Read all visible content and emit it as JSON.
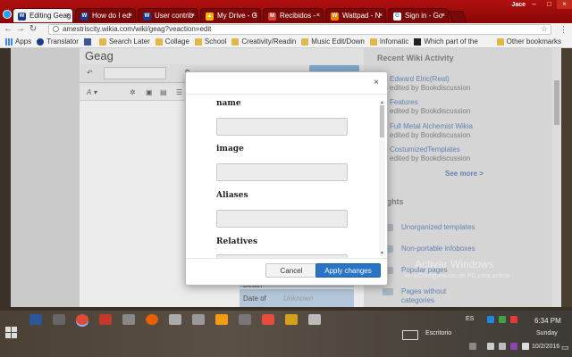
{
  "browser": {
    "profile": "Jace",
    "tabs": [
      {
        "title": "Editing Geag",
        "icon_color": "#1a3b8c",
        "icon": "W",
        "active": true
      },
      {
        "title": "How do I ed",
        "icon_color": "#1a3b8c",
        "icon": "W",
        "active": false
      },
      {
        "title": "User contrib",
        "icon_color": "#1a3b8c",
        "icon": "W",
        "active": false
      },
      {
        "title": "My Drive - G",
        "icon_color": "#f4b400",
        "icon": "▲",
        "active": false
      },
      {
        "title": "Recibidos -",
        "icon_color": "#db4437",
        "icon": "M",
        "active": false
      },
      {
        "title": "Wattpad - N",
        "icon_color": "#f57c00",
        "icon": "W",
        "active": false
      },
      {
        "title": "Sign in - Go",
        "icon_color": "#ffffff",
        "icon": "G",
        "active": false
      }
    ],
    "tab_close": "×",
    "window_controls": [
      "–",
      "□",
      "×"
    ],
    "url": "amestriscity.wikia.com/wiki/geag?veaction=edit",
    "bookmarks": [
      {
        "label": "Apps",
        "icon": "apps"
      },
      {
        "label": "Translator",
        "icon": "wikia"
      },
      {
        "label": "",
        "icon": "facebook"
      },
      {
        "label": "Search Later",
        "icon": "folder"
      },
      {
        "label": "Collage",
        "icon": "folder"
      },
      {
        "label": "School",
        "icon": "folder"
      },
      {
        "label": "Creativity/Readin",
        "icon": "folder"
      },
      {
        "label": "Music Edit/Down",
        "icon": "folder"
      },
      {
        "label": "Infomatic",
        "icon": "folder"
      },
      {
        "label": "Which part of the",
        "icon": "bookmark"
      }
    ],
    "other_bookmarks": "Other bookmarks"
  },
  "page": {
    "title": "Geag",
    "infobox": [
      {
        "label": "Death",
        "value": ""
      },
      {
        "label": "Date of",
        "value": "Unknown"
      }
    ],
    "rail": {
      "activity_heading": "Recent Wiki Activity",
      "activity": [
        {
          "title": "Edward Elric(Real)",
          "sub": "edited by Bookdiscussion"
        },
        {
          "title": "Features",
          "sub": "edited by Bookdiscussion"
        },
        {
          "title": "Full Metal Alchemist Wikia",
          "sub": "edited by Bookdiscussion"
        },
        {
          "title": "CostumizedTemplates",
          "sub": "edited by Bookdiscussion"
        }
      ],
      "see_more": "See more >",
      "insights_heading": "ights",
      "insights": [
        "Unorganized templates",
        "Non-portable infoboxes",
        "Popular pages",
        "Pages without",
        "categories"
      ]
    },
    "watermark": "Activar Windows",
    "watermark_sub": "Ve a Configuración de PC para activar"
  },
  "modal": {
    "close_icon": "×",
    "fields": [
      {
        "label": "name",
        "value": ""
      },
      {
        "label": "image",
        "value": ""
      },
      {
        "label": "Aliases",
        "value": ""
      },
      {
        "label": "Relatives",
        "value": ""
      }
    ],
    "cancel_label": "Cancel",
    "apply_label": "Apply changes"
  },
  "taskbar": {
    "language": "ES",
    "desktop_label": "Escritorio",
    "time": "6:34 PM",
    "day": "Sunday",
    "date": "10/2/2016"
  }
}
